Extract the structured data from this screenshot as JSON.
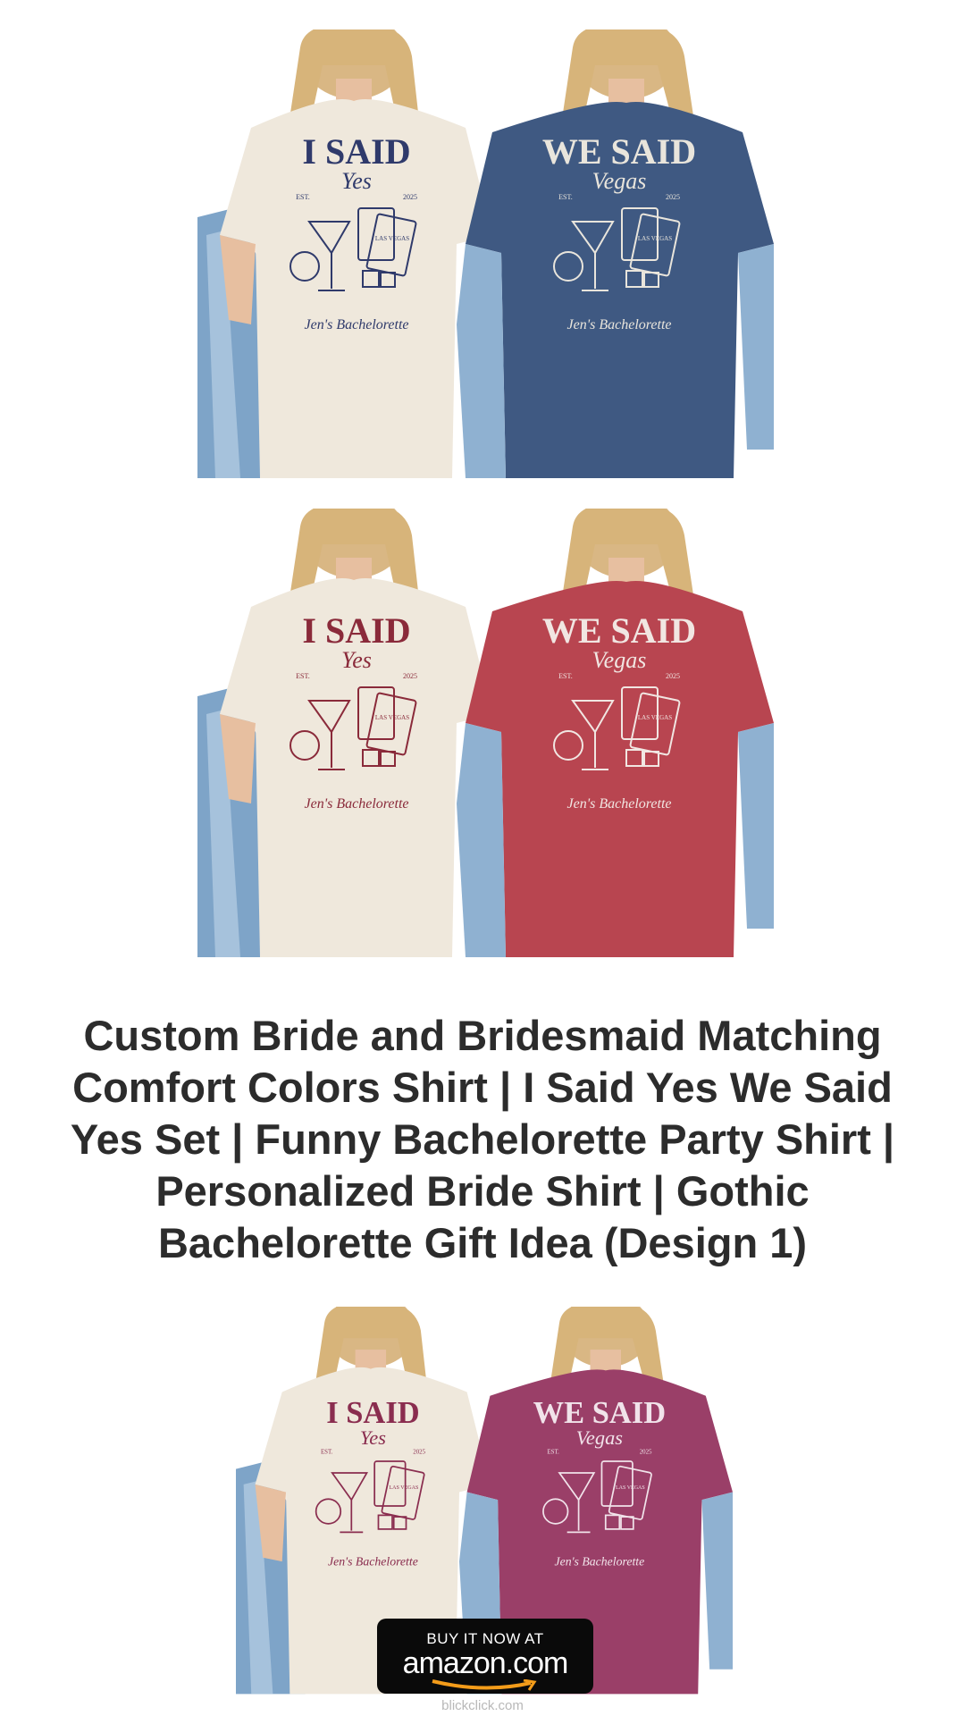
{
  "product": {
    "title": "Custom Bride and Bridesmaid Matching Comfort Colors Shirt | I Said Yes We Said Yes Set | Funny Bachelorette Party Shirt | Personalized Bride Shirt | Gothic Bachelorette Gift Idea (Design 1)"
  },
  "images": [
    {
      "left_shirt": {
        "color": "#efe8dc",
        "ink": "#2f3a6b",
        "line1": "I SAID",
        "line2": "Yes",
        "est": "EST.",
        "year": "2025",
        "sign": "Jen's Bachelorette"
      },
      "right_shirt": {
        "color": "#3f5982",
        "ink": "#e9e5dc",
        "line1": "WE SAID",
        "line2": "Vegas",
        "est": "EST.",
        "year": "2025",
        "sign": "Jen's Bachelorette"
      }
    },
    {
      "left_shirt": {
        "color": "#efe8dc",
        "ink": "#8a2a3a",
        "line1": "I SAID",
        "line2": "Yes",
        "est": "EST.",
        "year": "2025",
        "sign": "Jen's Bachelorette"
      },
      "right_shirt": {
        "color": "#b84550",
        "ink": "#f1e6e2",
        "line1": "WE SAID",
        "line2": "Vegas",
        "est": "EST.",
        "year": "2025",
        "sign": "Jen's Bachelorette"
      }
    },
    {
      "left_shirt": {
        "color": "#efe8dc",
        "ink": "#8a2d4f",
        "line1": "I SAID",
        "line2": "Yes",
        "est": "EST.",
        "year": "2025",
        "sign": "Jen's Bachelorette"
      },
      "right_shirt": {
        "color": "#9a3f68",
        "ink": "#f1e3ea",
        "line1": "WE SAID",
        "line2": "Vegas",
        "est": "EST.",
        "year": "2025",
        "sign": "Jen's Bachelorette"
      }
    }
  ],
  "card_text": "LAS VEGAS",
  "buy_button": {
    "line1": "BUY IT NOW AT",
    "line2": "amazon.com"
  },
  "footer": {
    "text": "blickclick.com"
  },
  "colors": {
    "title": "#2c2c2c",
    "button_bg": "#0a0a0a",
    "amazon_orange": "#f39c1a",
    "denim": "#7ea4c8"
  }
}
